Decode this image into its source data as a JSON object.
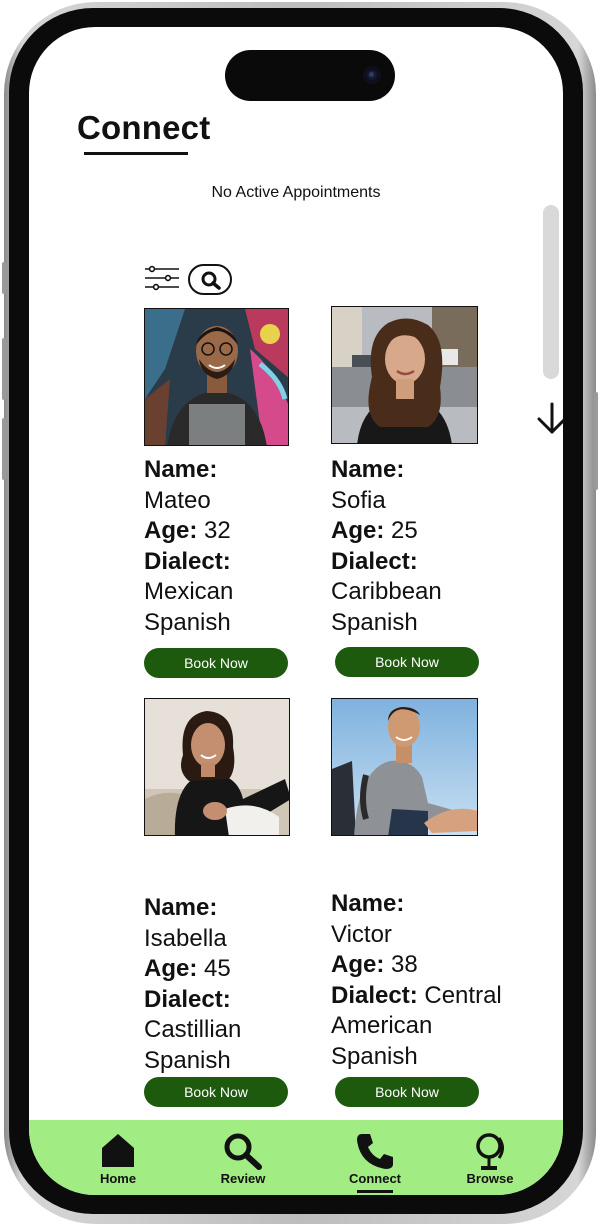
{
  "header": {
    "title": "Connect"
  },
  "status": {
    "no_appointments": "No Active Appointments"
  },
  "icons": {
    "filter": "filter-sliders-icon",
    "search": "search-icon",
    "scroll_down": "arrow-down-icon"
  },
  "profiles": [
    {
      "name_label": "Name:",
      "name": "Mateo",
      "age_label": "Age:",
      "age": "32",
      "dialect_label": "Dialect:",
      "dialect_line1": "Mexican",
      "dialect_line2": "Spanish",
      "button": "Book Now"
    },
    {
      "name_label": "Name:",
      "name": "Sofia",
      "age_label": "Age:",
      "age": "25",
      "dialect_label": "Dialect:",
      "dialect_line1": "Caribbean",
      "dialect_line2": "Spanish",
      "button": "Book Now"
    },
    {
      "name_label": "Name:",
      "name": "Isabella",
      "age_label": "Age:",
      "age": "45",
      "dialect_label": "Dialect:",
      "dialect_line1": "Castillian",
      "dialect_line2": "Spanish",
      "button": "Book Now"
    },
    {
      "name_label": "Name:",
      "name": "Victor",
      "age_label": "Age:",
      "age": "38",
      "dialect_label": "Dialect:",
      "dialect_inline": "Central",
      "dialect_line1": "American",
      "dialect_line2": "Spanish",
      "button": "Book Now"
    }
  ],
  "nav": {
    "items": [
      {
        "label": "Home",
        "icon": "home-icon"
      },
      {
        "label": "Review",
        "icon": "magnifier-icon"
      },
      {
        "label": "Connect",
        "icon": "phone-icon",
        "active": true
      },
      {
        "label": "Browse",
        "icon": "globe-icon"
      }
    ]
  },
  "colors": {
    "button_green": "#1e5a0d",
    "nav_green": "#a1ed83"
  }
}
